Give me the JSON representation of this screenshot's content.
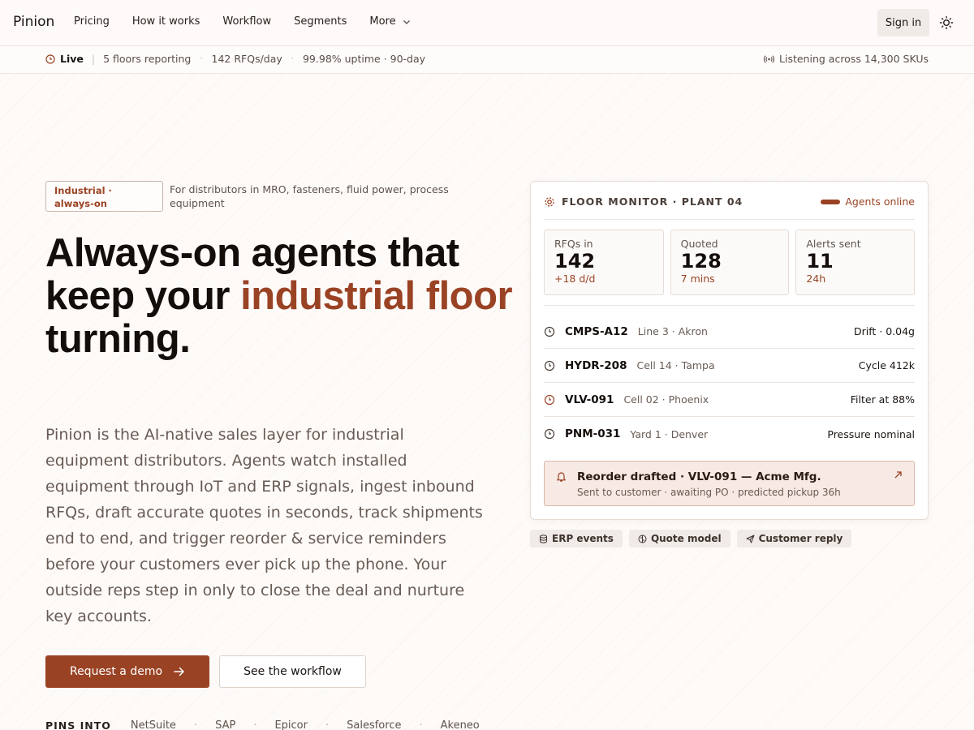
{
  "nav": {
    "brand": "Pinion",
    "links": [
      "Pricing",
      "How it works",
      "Workflow",
      "Segments",
      "More"
    ],
    "signin": "Sign in",
    "theme_icon": "sun-icon"
  },
  "status": {
    "live": "Live",
    "floors": "5 floors reporting",
    "rfqs": "142 RFQs/day",
    "uptime": "99.98% uptime · 90-day",
    "listening": "Listening across 14,300 SKUs"
  },
  "hero": {
    "badge": "Industrial · always-on",
    "badge_note": "For distributors in MRO, fasteners, fluid power, process equipment",
    "title_pre": "Always-on agents that keep your",
    "title_accent": "industrial floor",
    "title_post": "turning.",
    "lede": "Pinion is the AI-native sales layer for industrial equipment distributors. Agents watch installed equipment through IoT and ERP signals, ingest inbound RFQs, draft accurate quotes in seconds, track shipments end to end, and trigger reorder & service reminders before your customers ever pick up the phone. Your outside reps step in only to close the deal and nurture key accounts.",
    "cta_primary": "Request a demo",
    "cta_secondary": "See the workflow",
    "pins_label": "PINS INTO",
    "pins": [
      "NetSuite",
      "SAP",
      "Epicor",
      "Salesforce",
      "Akeneo"
    ]
  },
  "monitor": {
    "title": "FLOOR MONITOR · PLANT 04",
    "online": "Agents online",
    "stats": [
      {
        "label": "RFQs in",
        "value": "142",
        "delta": "+18 d/d"
      },
      {
        "label": "Quoted",
        "value": "128",
        "delta": "7 mins"
      },
      {
        "label": "Alerts sent",
        "value": "11",
        "delta": "24h"
      }
    ],
    "rows": [
      {
        "code": "CMPS-A12",
        "loc": "Line 3 · Akron",
        "value": "Drift · 0.04g",
        "alert": false
      },
      {
        "code": "HYDR-208",
        "loc": "Cell 14 · Tampa",
        "value": "Cycle 412k",
        "alert": false
      },
      {
        "code": "VLV-091",
        "loc": "Cell 02 · Phoenix",
        "value": "Filter at 88%",
        "alert": true
      },
      {
        "code": "PNM-031",
        "loc": "Yard 1 · Denver",
        "value": "Pressure nominal",
        "alert": false
      }
    ],
    "alert": {
      "title": "Reorder drafted · VLV-091 — Acme Mfg.",
      "sub": "Sent to customer · awaiting PO · predicted pickup 36h"
    }
  },
  "chips": [
    "ERP events",
    "Quote model",
    "Customer reply"
  ],
  "colors": {
    "accent": "#9a4324",
    "alert_bg": "#f7e9e3"
  }
}
